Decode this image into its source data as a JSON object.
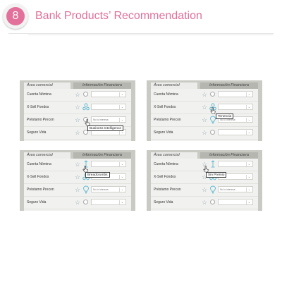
{
  "header": {
    "step_number": "8",
    "title": "Bank Products’ Recommendation",
    "accent_color": "#e2709a"
  },
  "panel_common": {
    "tab_active": "Área comercial",
    "tab_inactive": "Información Financiera",
    "rows": [
      {
        "label": "Cuenta Nómina"
      },
      {
        "label": "X-Sell Fondos"
      },
      {
        "label": "Préstamo Precon"
      },
      {
        "label": "Seguro Vida"
      }
    ],
    "select_placeholder": "No lo interesa",
    "icons": {
      "star": "star-icon",
      "radio": "radio-icon",
      "breadcrumb": "breadcrumb-icon",
      "tenencia": "people-icon",
      "bulb": "bulb-icon",
      "cursor": "hand-cursor-icon"
    }
  },
  "panels": [
    {
      "tooltip": "Business Intelligence"
    },
    {
      "tooltip": "Tenencia"
    },
    {
      "tooltip": "Breadcrumbs"
    },
    {
      "tooltip": "Sin Premio"
    }
  ]
}
